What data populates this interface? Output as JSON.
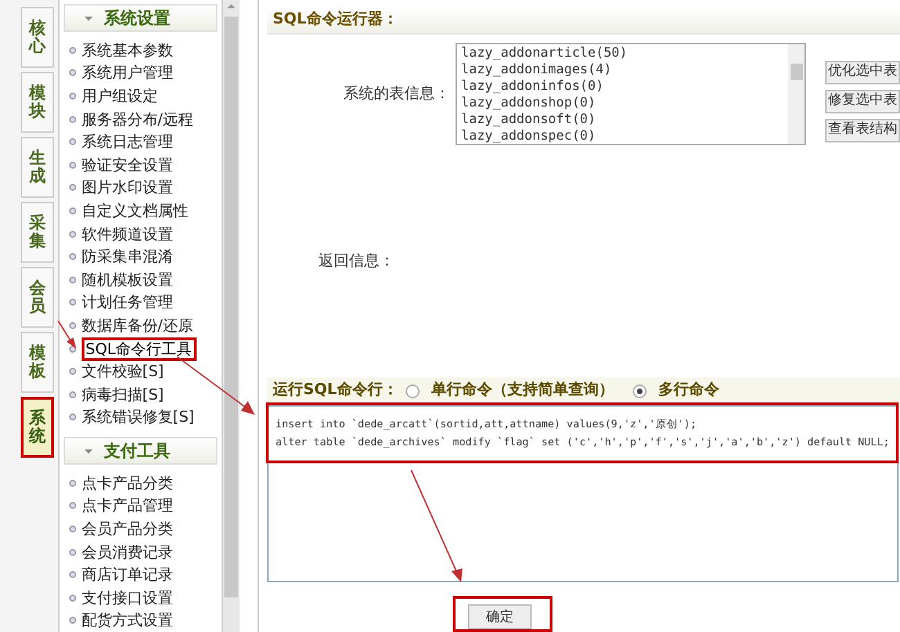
{
  "side_tabs": [
    {
      "label": "核心",
      "selected": false
    },
    {
      "label": "模块",
      "selected": false
    },
    {
      "label": "生成",
      "selected": false
    },
    {
      "label": "采集",
      "selected": false
    },
    {
      "label": "会员",
      "selected": false
    },
    {
      "label": "模板",
      "selected": false
    },
    {
      "label": "系统",
      "selected": true
    }
  ],
  "menu_sections": [
    {
      "title": "系统设置",
      "items": [
        {
          "label": "系统基本参数",
          "selected": false
        },
        {
          "label": "系统用户管理",
          "selected": false
        },
        {
          "label": "用户组设定",
          "selected": false
        },
        {
          "label": "服务器分布/远程",
          "selected": false
        },
        {
          "label": "系统日志管理",
          "selected": false
        },
        {
          "label": "验证安全设置",
          "selected": false
        },
        {
          "label": "图片水印设置",
          "selected": false
        },
        {
          "label": "自定义文档属性",
          "selected": false
        },
        {
          "label": "软件频道设置",
          "selected": false
        },
        {
          "label": "防采集串混淆",
          "selected": false
        },
        {
          "label": "随机模板设置",
          "selected": false
        },
        {
          "label": "计划任务管理",
          "selected": false
        },
        {
          "label": "数据库备份/还原",
          "selected": false
        },
        {
          "label": "SQL命令行工具",
          "selected": true
        },
        {
          "label": "文件校验[S]",
          "selected": false
        },
        {
          "label": "病毒扫描[S]",
          "selected": false
        },
        {
          "label": "系统错误修复[S]",
          "selected": false
        }
      ]
    },
    {
      "title": "支付工具",
      "items": [
        {
          "label": "点卡产品分类",
          "selected": false
        },
        {
          "label": "点卡产品管理",
          "selected": false
        },
        {
          "label": "会员产品分类",
          "selected": false
        },
        {
          "label": "会员消费记录",
          "selected": false
        },
        {
          "label": "商店订单记录",
          "selected": false
        },
        {
          "label": "支付接口设置",
          "selected": false
        },
        {
          "label": "配货方式设置",
          "selected": false
        }
      ]
    }
  ],
  "panel": {
    "title": "SQL命令运行器：",
    "tables_label": "系统的表信息：",
    "tables": [
      "lazy_addonarticle(50)",
      "lazy_addonimages(4)",
      "lazy_addoninfos(0)",
      "lazy_addonshop(0)",
      "lazy_addonsoft(0)",
      "lazy_addonspec(0)"
    ],
    "table_buttons": [
      "优化选中表",
      "修复选中表",
      "查看表结构"
    ],
    "result_label": "返回信息：",
    "run_label": "运行SQL命令行：",
    "modes": [
      {
        "label": "单行命令（支持简单查询）",
        "selected": false
      },
      {
        "label": "多行命令",
        "selected": true
      }
    ],
    "sql": "insert into `dede_arcatt`(sortid,att,attname) values(9,'z','原创');\nalter table `dede_archives` modify `flag` set ('c','h','p','f','s','j','a','b','z') default NULL;",
    "submit": "确定"
  }
}
